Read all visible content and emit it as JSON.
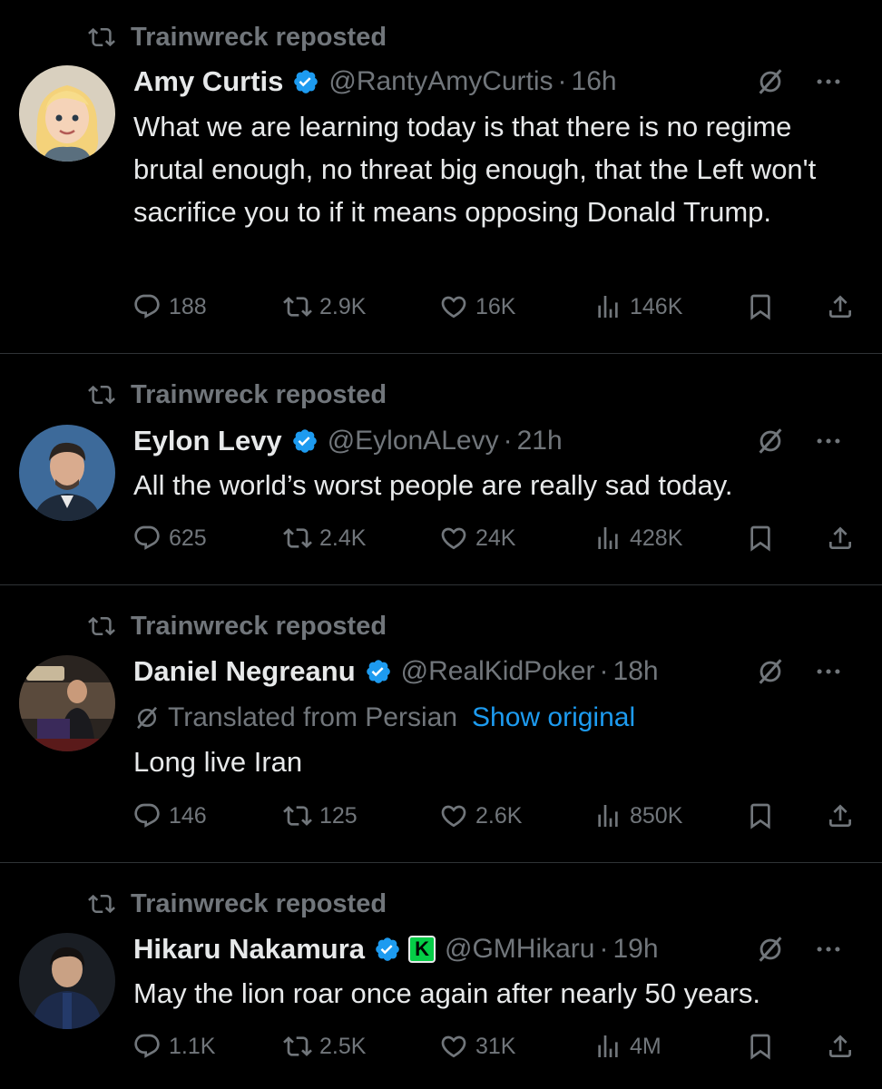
{
  "colors": {
    "background": "#000000",
    "text": "#e7e9ea",
    "muted": "#71767b",
    "link": "#1d9bf0",
    "verified": "#1d9bf0",
    "divider": "#2f3336"
  },
  "tweets": [
    {
      "reposted_by": "Trainwreck reposted",
      "name": "Amy Curtis",
      "handle": "@RantyAmyCurtis",
      "dot": "·",
      "time": "16h",
      "text": "What we are learning today is that there is no regime brutal enough, no threat big enough, that the Left won't sacrifice you to if it means opposing Donald Trump.",
      "replies": "188",
      "reposts": "2.9K",
      "likes": "16K",
      "views": "146K",
      "avatar_icon": "cartoon-avatar"
    },
    {
      "reposted_by": "Trainwreck reposted",
      "name": "Eylon Levy",
      "handle": "@EylonALevy",
      "dot": "·",
      "time": "21h",
      "text": "All the world’s worst people are really sad today.",
      "replies": "625",
      "reposts": "2.4K",
      "likes": "24K",
      "views": "428K",
      "avatar_icon": "photo-avatar"
    },
    {
      "reposted_by": "Trainwreck reposted",
      "name": "Daniel Negreanu",
      "handle": "@RealKidPoker",
      "dot": "·",
      "time": "18h",
      "translated": "Translated from Persian",
      "show_original": "Show original",
      "text": "Long live Iran",
      "replies": "146",
      "reposts": "125",
      "likes": "2.6K",
      "views": "850K",
      "avatar_icon": "photo-avatar"
    },
    {
      "reposted_by": "Trainwreck reposted",
      "name": "Hikaru Nakamura",
      "handle": "@GMHikaru",
      "dot": "·",
      "time": "19h",
      "affiliate_badge": "K",
      "text": "May the lion roar once again after nearly 50 years.",
      "replies": "1.1K",
      "reposts": "2.5K",
      "likes": "31K",
      "views": "4M",
      "avatar_icon": "photo-avatar"
    }
  ]
}
